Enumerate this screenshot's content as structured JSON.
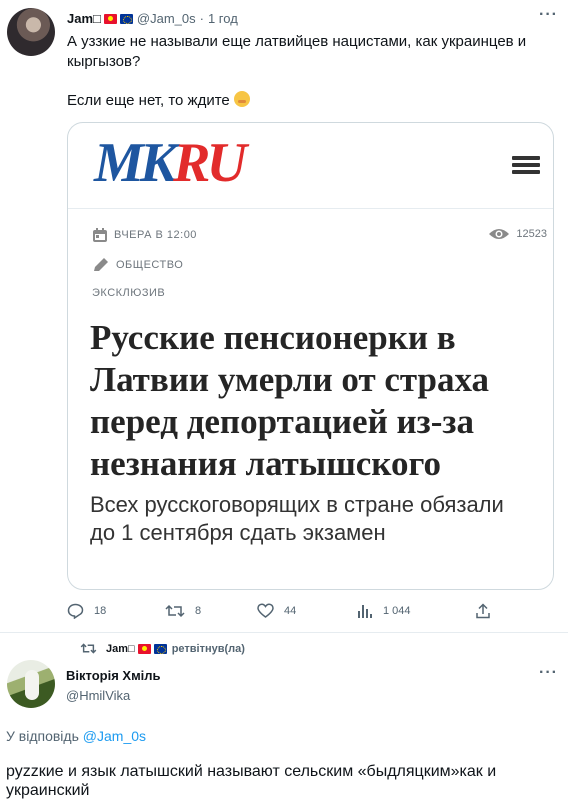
{
  "tweet": {
    "author_name": "Jam",
    "author_glyph": "□",
    "handle": "@Jam_0s",
    "time": "1 год",
    "text_line1": "А уззкие не называли еще латвийцев нацистами, как украинцев и кыргызов?",
    "text_line2": "Если еще нет, то ждите",
    "more": "···"
  },
  "card": {
    "logo_mk": "MK",
    "logo_ru": "RU",
    "date": "ВЧЕРА В 12:00",
    "views": "12523",
    "section": "ОБЩЕСТВО",
    "tag": "ЭКСКЛЮЗИВ",
    "headline": "Русские пенсионерки в Латвии умерли от страха перед депортацией из-за незнания латышского",
    "lead": "Всех русскоговорящих в стране обязали до 1 сентября сдать экзамен"
  },
  "actions": {
    "replies": "18",
    "retweets": "8",
    "likes": "44",
    "views": "1 044"
  },
  "retweet": {
    "name": "Jam",
    "glyph": "□",
    "label": "ретвітнув(ла)"
  },
  "reply": {
    "name": "Вікторія Хміль",
    "handle": "@HmilVika",
    "more": "···",
    "reply_prefix": "У відповідь",
    "reply_to": "@Jam_0s",
    "text": "руzzкие и язык латышский называют сельским «быдляцким»как и украинский"
  },
  "colors": {
    "accent": "#1d9bf0",
    "mk_blue": "#1e56a0",
    "mk_red": "#e22b2b"
  }
}
